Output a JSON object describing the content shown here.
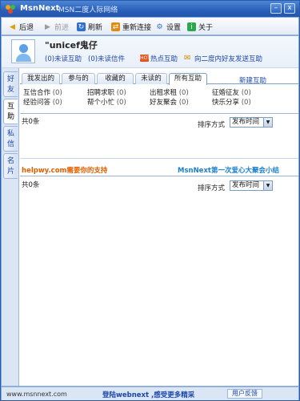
{
  "window": {
    "app_name": "MsnNext",
    "subtitle": "MSN二度人际网络",
    "min_glyph": "–",
    "close_glyph": "x"
  },
  "toolbar": {
    "back_label": "后退",
    "forward_label": "前进",
    "refresh_label": "刷新",
    "reconnect_label": "重新连接",
    "settings_label": "设置",
    "about_label": "关于"
  },
  "profile": {
    "nickname": "\"unicef鬼仔",
    "unread_interactions": "(0)未读互助",
    "unread_messages": "(0)未读信件",
    "hot_badge": "HOT",
    "hot_label": "热点互助",
    "broadcast_label": "向二度内好友发送互助"
  },
  "sidetabs": [
    "好友",
    "互助",
    "私信",
    "名片"
  ],
  "tabs": [
    "我发出的",
    "参与的",
    "收藏的",
    "未读的",
    "所有互助"
  ],
  "new_link": "新建互助",
  "categories": [
    {
      "name": "互信合作",
      "count": "(0)"
    },
    {
      "name": "招聘求职",
      "count": "(0)"
    },
    {
      "name": "出租求租",
      "count": "(0)"
    },
    {
      "name": "征婚征友",
      "count": "(0)"
    },
    {
      "name": "经验问答",
      "count": "(0)"
    },
    {
      "name": "帮个小忙",
      "count": "(0)"
    },
    {
      "name": "好友聚会",
      "count": "(0)"
    },
    {
      "name": "快乐分享",
      "count": "(0)"
    }
  ],
  "list1": {
    "total": "共0条",
    "sort_label": "排序方式",
    "sort_value": "发布时间"
  },
  "promo": {
    "left": "helpwy.com需要你的支持",
    "right": "MsnNext第一次爱心大聚会小结"
  },
  "list2": {
    "total": "共0条",
    "sort_label": "排序方式",
    "sort_value": "发布时间"
  },
  "footer": {
    "url": "www.msnnext.com",
    "login_text": "登陆webnext ,感受更多精采",
    "feedback_label": "用户反馈"
  }
}
